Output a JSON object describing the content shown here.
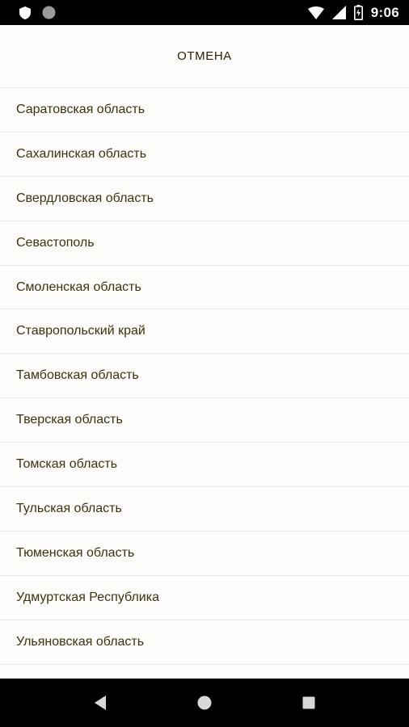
{
  "status_bar": {
    "time": "9:06",
    "icons": [
      "shield-icon",
      "circle-icon",
      "wifi-icon",
      "signal-icon",
      "battery-icon"
    ]
  },
  "header": {
    "cancel_label": "ОТМЕНА"
  },
  "regions": [
    "Саратовская область",
    "Сахалинская область",
    "Свердловская область",
    "Севастополь",
    "Смоленская область",
    "Ставропольский край",
    "Тамбовская область",
    "Тверская область",
    "Томская область",
    "Тульская область",
    "Тюменская область",
    "Удмуртская Республика",
    "Ульяновская область"
  ],
  "nav_bar": {
    "icons": [
      "back-icon",
      "home-icon",
      "recents-icon"
    ]
  },
  "colors": {
    "background": "#fdfcfa",
    "text": "#3d3210",
    "divider": "#ece9e2",
    "bars": "#000000"
  }
}
